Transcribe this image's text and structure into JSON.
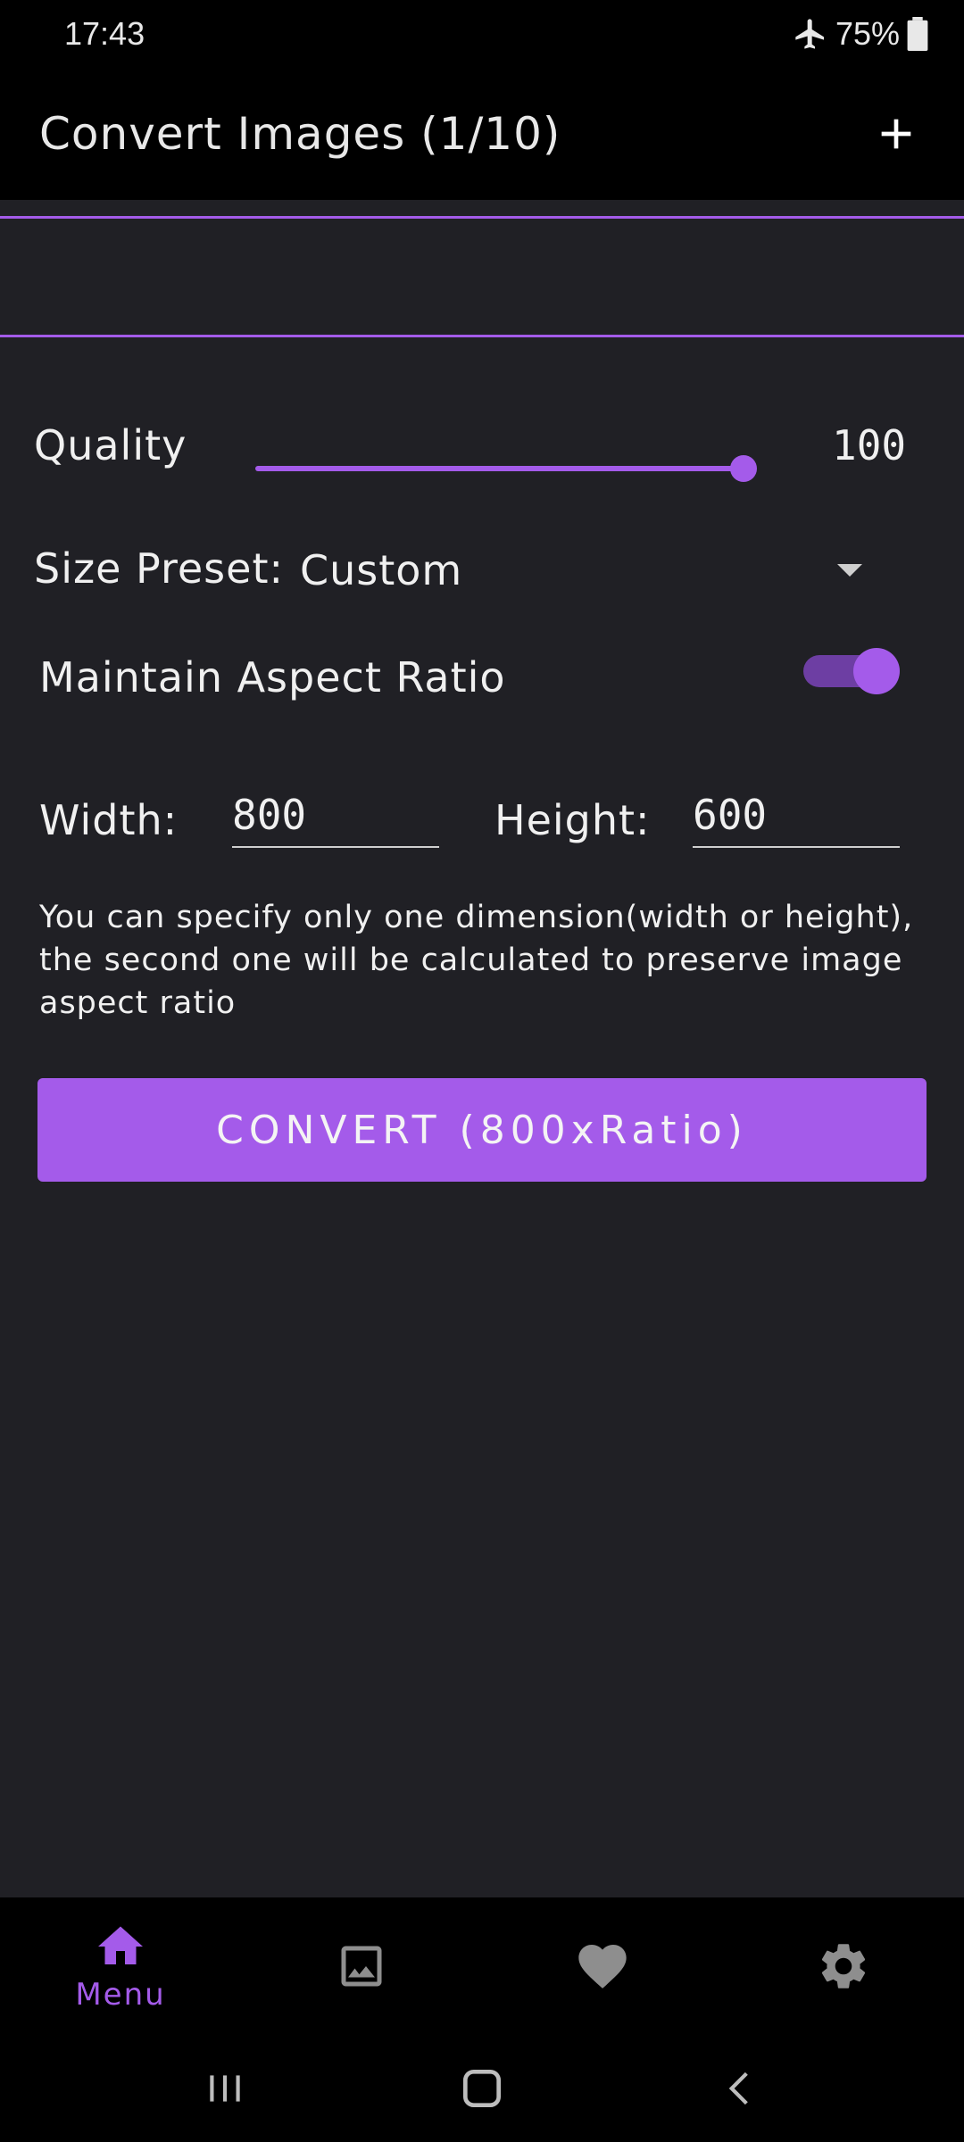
{
  "status_bar": {
    "time": "17:43",
    "battery": "75%"
  },
  "app_bar": {
    "title": "Convert Images (1/10)"
  },
  "settings": {
    "quality_label": "Quality",
    "quality_value": "100",
    "quality_level": 1.0,
    "size_preset_label": "Size Preset:",
    "size_preset_value": "Custom",
    "aspect_label": "Maintain Aspect Ratio",
    "aspect_enabled": true,
    "width_label": "Width:",
    "width_value": "800",
    "height_label": "Height:",
    "height_value": "600",
    "hint": "You can specify only one dimension(width or height), the second one will be calculated to preserve image aspect ratio",
    "convert_label": "CONVERT (800xRatio)"
  },
  "bottom_nav": {
    "items": [
      {
        "icon": "home-icon",
        "label": "Menu",
        "active": true
      },
      {
        "icon": "image-icon",
        "label": ""
      },
      {
        "icon": "heart-icon",
        "label": ""
      },
      {
        "icon": "gear-icon",
        "label": ""
      }
    ]
  },
  "colors": {
    "accent": "#a45bea",
    "background": "#202025",
    "bar": "#000000"
  }
}
